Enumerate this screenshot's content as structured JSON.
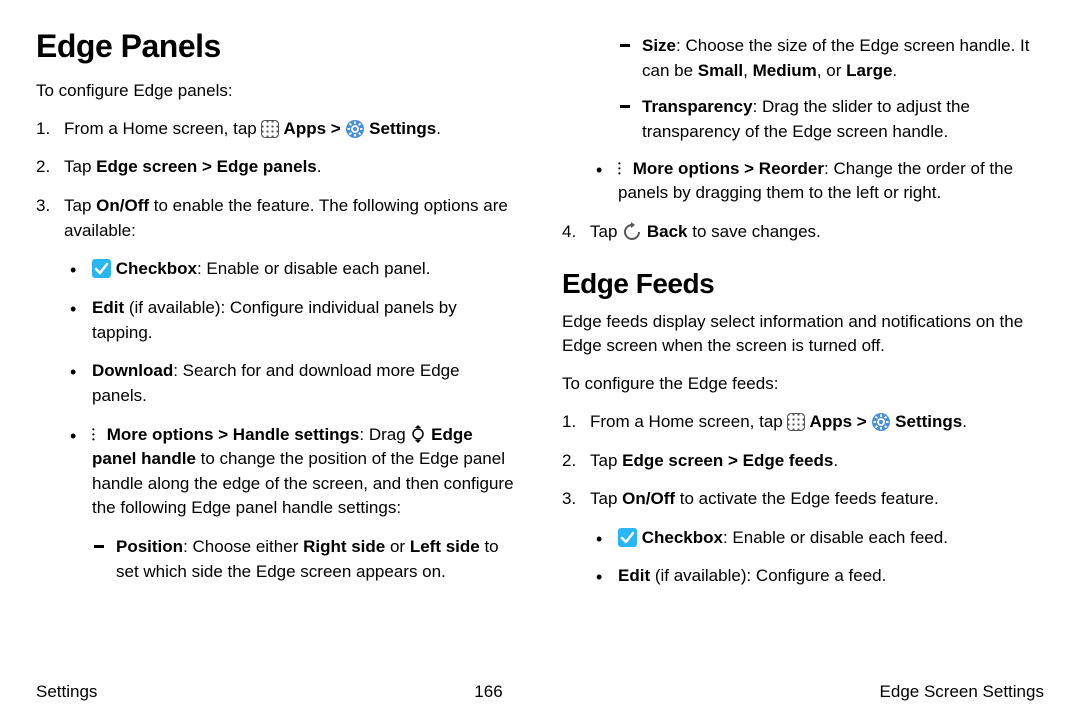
{
  "left": {
    "heading": "Edge Panels",
    "intro": "To configure Edge panels:",
    "step1_a": "From a Home screen, tap ",
    "step1_apps": " Apps",
    "step1_sep": " > ",
    "step1_settings": " Settings",
    "step1_dot": ".",
    "step2_a": "Tap ",
    "step2_b": "Edge screen > Edge panels",
    "step2_c": ".",
    "step3_a": "Tap ",
    "step3_b": "On/Off",
    "step3_c": " to enable the feature. The following options are available:",
    "b_check_b": " Checkbox",
    "b_check_t": ": Enable or disable each panel.",
    "b_edit_b": "Edit",
    "b_edit_t": " (if available): Configure individual panels by tapping.",
    "b_dl_b": "Download",
    "b_dl_t": ": Search for and download more Edge panels.",
    "b_more_b": " More options > Handle settings",
    "b_more_t1": ": Drag ",
    "b_more_hb": " Edge panel handle",
    "b_more_t2": " to change the position of the Edge panel handle along the edge of the screen, and then configure the following Edge panel handle settings:",
    "d_pos_b": "Position",
    "d_pos_t1": ": Choose either ",
    "d_pos_b2": "Right side",
    "d_pos_t2": " or ",
    "d_pos_b3": "Left side",
    "d_pos_t3": " to set which side the Edge screen appears on."
  },
  "right": {
    "d_size_b": "Size",
    "d_size_t1": ": Choose the size of the Edge screen handle. It can be ",
    "d_size_b2": "Small",
    "d_size_t2": ", ",
    "d_size_b3": "Medium",
    "d_size_t3": ", or ",
    "d_size_b4": "Large",
    "d_size_t4": ".",
    "d_trans_b": "Transparency",
    "d_trans_t": ": Drag the slider to adjust the transparency of the Edge screen handle.",
    "b_reorder_b": " More options > Reorder",
    "b_reorder_t": ": Change the order of the panels by dragging them to the left or right.",
    "step4_a": "Tap ",
    "step4_b": " Back",
    "step4_c": " to save changes.",
    "heading2": "Edge Feeds",
    "feeds_intro": "Edge feeds display select information and notifications on the Edge screen when the screen is turned off.",
    "feeds_conf": "To configure the Edge feeds:",
    "fs1_a": "From a Home screen, tap ",
    "fs1_apps": " Apps",
    "fs1_sep": " > ",
    "fs1_settings": " Settings",
    "fs1_dot": ".",
    "fs2_a": "Tap ",
    "fs2_b": "Edge screen > Edge feeds",
    "fs2_c": ".",
    "fs3_a": "Tap ",
    "fs3_b": "On/Off",
    "fs3_c": " to activate the Edge feeds feature.",
    "fb_check_b": " Checkbox",
    "fb_check_t": ": Enable or disable each feed.",
    "fb_edit_b": "Edit",
    "fb_edit_t": " (if available): Configure a feed."
  },
  "footer": {
    "left": "Settings",
    "center": "166",
    "right": "Edge Screen Settings"
  }
}
